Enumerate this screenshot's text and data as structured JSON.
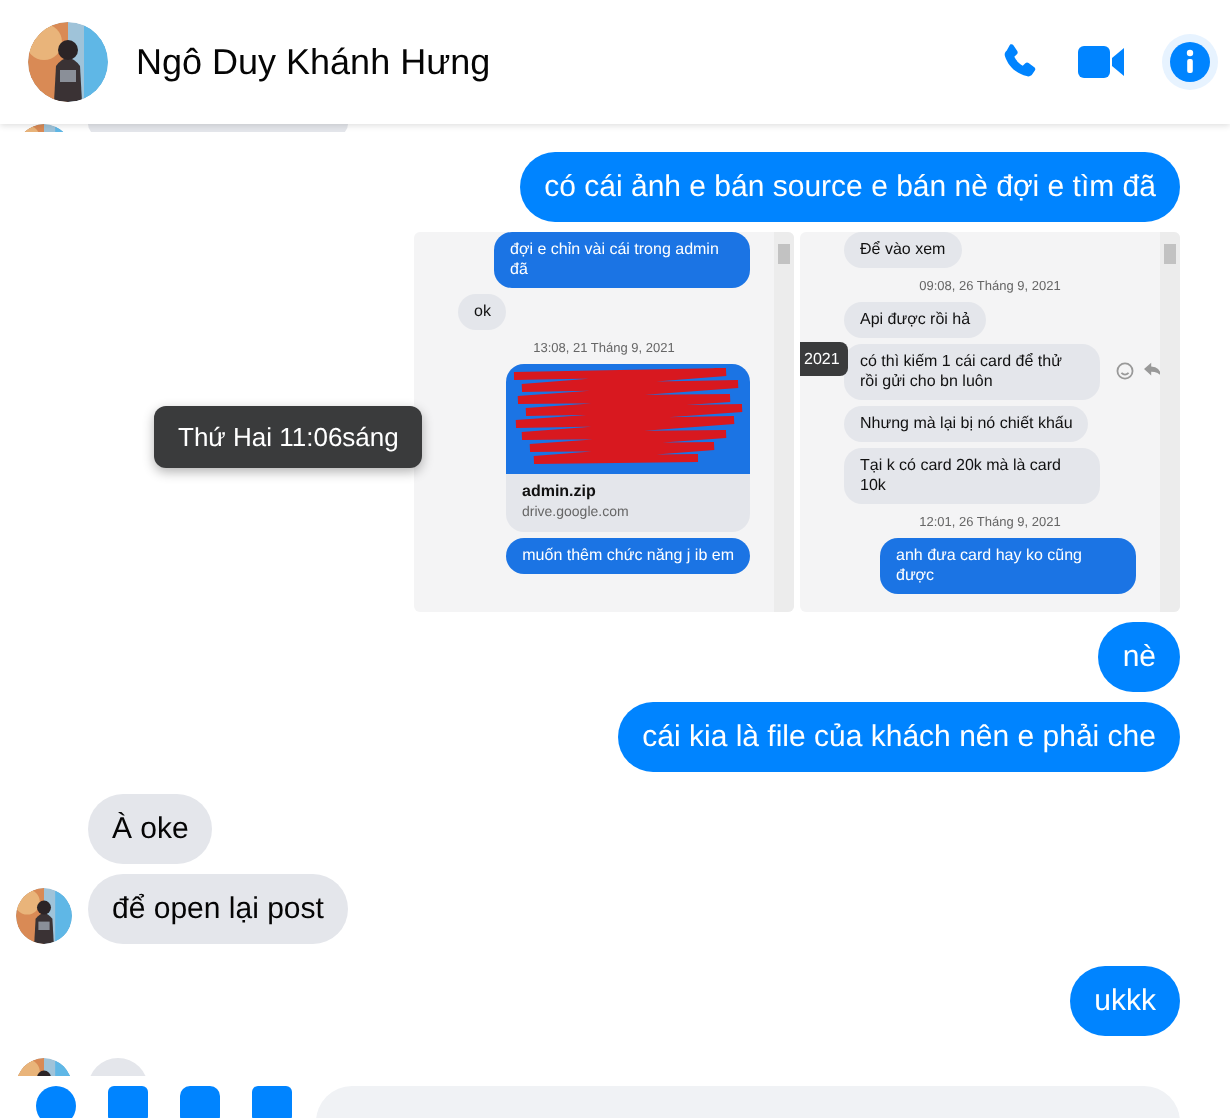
{
  "header": {
    "name": "Ngô Duy Khánh Hưng"
  },
  "messages": [
    {
      "kind": "stub",
      "outgoing": false,
      "avatar": true
    },
    {
      "kind": "text",
      "outgoing": true,
      "text": "có cái ảnh e bán source e bán nè đợi e tìm đã"
    },
    {
      "kind": "images",
      "outgoing": true,
      "images": [
        {
          "items": [
            {
              "kind": "out",
              "text": "đợi e chỉn vài cái trong admin đã"
            },
            {
              "kind": "in",
              "text": "ok"
            },
            {
              "kind": "time",
              "text": "13:08, 21 Tháng 9, 2021"
            },
            {
              "kind": "link",
              "title": "admin.zip",
              "domain": "drive.google.com"
            },
            {
              "kind": "out",
              "text": "muốn thêm chức năng j ib em"
            }
          ]
        },
        {
          "edge_label": "2021",
          "items": [
            {
              "kind": "in",
              "text": "Để vào xem"
            },
            {
              "kind": "time",
              "text": "09:08, 26 Tháng 9, 2021"
            },
            {
              "kind": "in",
              "text": "Api được rồi hả"
            },
            {
              "kind": "in",
              "text": "có thì kiếm 1 cái card để thử rồi gửi cho bn luôn",
              "actions": true
            },
            {
              "kind": "in",
              "text": "Nhưng mà lại bị nó chiết khấu"
            },
            {
              "kind": "in",
              "text": "Tại k có card 20k mà là card 10k"
            },
            {
              "kind": "time",
              "text": "12:01, 26 Tháng 9, 2021"
            },
            {
              "kind": "out",
              "text": "anh đưa card hay ko cũng được"
            }
          ]
        }
      ]
    },
    {
      "kind": "text",
      "outgoing": true,
      "text": "nè"
    },
    {
      "kind": "text",
      "outgoing": true,
      "text": "cái kia là file của khách nên e phải che"
    },
    {
      "kind": "text",
      "outgoing": false,
      "text": "À oke",
      "avatar": false
    },
    {
      "kind": "text",
      "outgoing": false,
      "text": "để open lại post",
      "avatar": true
    },
    {
      "kind": "text",
      "outgoing": true,
      "text": "ukkk"
    },
    {
      "kind": "stub",
      "outgoing": false,
      "avatar": true
    }
  ],
  "tooltip": "Thứ Hai 11:06sáng"
}
